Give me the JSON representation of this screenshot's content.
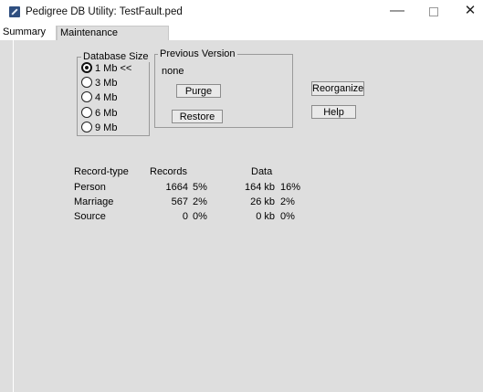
{
  "window": {
    "title": "Pedigree DB Utility: TestFault.ped",
    "min_glyph": "—",
    "close_glyph": "✕"
  },
  "tabs": [
    {
      "label": "Summary",
      "selected": false
    },
    {
      "label": "Maintenance",
      "selected": true
    }
  ],
  "database_size": {
    "legend": "Database Size",
    "options": [
      {
        "label": "1 Mb <<",
        "checked": true
      },
      {
        "label": "3 Mb",
        "checked": false
      },
      {
        "label": "4 Mb",
        "checked": false
      },
      {
        "label": "6 Mb",
        "checked": false
      },
      {
        "label": "9 Mb",
        "checked": false
      }
    ]
  },
  "previous_version": {
    "legend": "Previous Version",
    "value": "none",
    "purge_label": "Purge",
    "restore_label": "Restore"
  },
  "actions": {
    "reorganize_label": "Reorganize",
    "help_label": "Help"
  },
  "stats": {
    "headers": {
      "type": "Record-type",
      "records": "Records",
      "data": "Data"
    },
    "rows": [
      {
        "type": "Person",
        "records": "1664",
        "records_pct": "5%",
        "data": "164 kb",
        "data_pct": "16%"
      },
      {
        "type": "Marriage",
        "records": "567",
        "records_pct": "2%",
        "data": "26 kb",
        "data_pct": "2%"
      },
      {
        "type": "Source",
        "records": "0",
        "records_pct": "0%",
        "data": "0 kb",
        "data_pct": "0%"
      }
    ]
  }
}
